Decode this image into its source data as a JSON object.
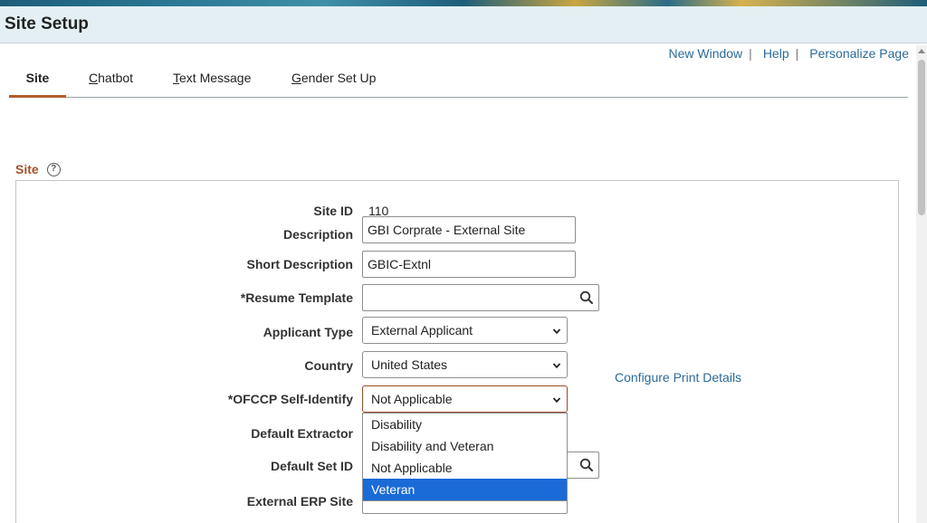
{
  "page": {
    "title": "Site Setup"
  },
  "top_links": {
    "new_window": "New Window",
    "separator": "|",
    "help": "Help",
    "personalize": "Personalize Page"
  },
  "tabs": [
    {
      "label": "Site",
      "active": true
    },
    {
      "label": "Chatbot",
      "mnemonic": "C",
      "rest": "hatbot"
    },
    {
      "label": "Text Message",
      "mnemonic": "T",
      "rest": "ext Message"
    },
    {
      "label": "Gender Set Up",
      "mnemonic": "G",
      "rest": "ender Set Up"
    }
  ],
  "section": {
    "title": "Site",
    "help_icon": "?"
  },
  "form": {
    "site_id": {
      "label": "Site ID",
      "value": "110"
    },
    "description": {
      "label": "Description",
      "value": "GBI Corprate - External Site"
    },
    "short_description": {
      "label": "Short Description",
      "value": "GBIC-Extnl"
    },
    "resume_template": {
      "label": "*Resume Template",
      "value": ""
    },
    "applicant_type": {
      "label": "Applicant Type",
      "value": "External Applicant"
    },
    "country": {
      "label": "Country",
      "value": "United States"
    },
    "ofccp": {
      "label": "*OFCCP Self-Identify",
      "value": "Not Applicable",
      "options": [
        "Disability",
        "Disability and Veteran",
        "Not Applicable",
        "Veteran"
      ],
      "highlighted": "Veteran"
    },
    "default_extractor": {
      "label": "Default Extractor"
    },
    "default_set_id": {
      "label": "Default Set ID"
    },
    "external_erp_site": {
      "label": "External ERP Site"
    }
  },
  "configure_print": "Configure Print Details",
  "colors": {
    "accent_orange": "#a3522a",
    "link_blue": "#2a6b9a",
    "highlight_blue": "#1a6ad8",
    "title_bar": "#e3eff3"
  },
  "icons": [
    "search-icon",
    "chevron-down-icon",
    "help-icon"
  ]
}
